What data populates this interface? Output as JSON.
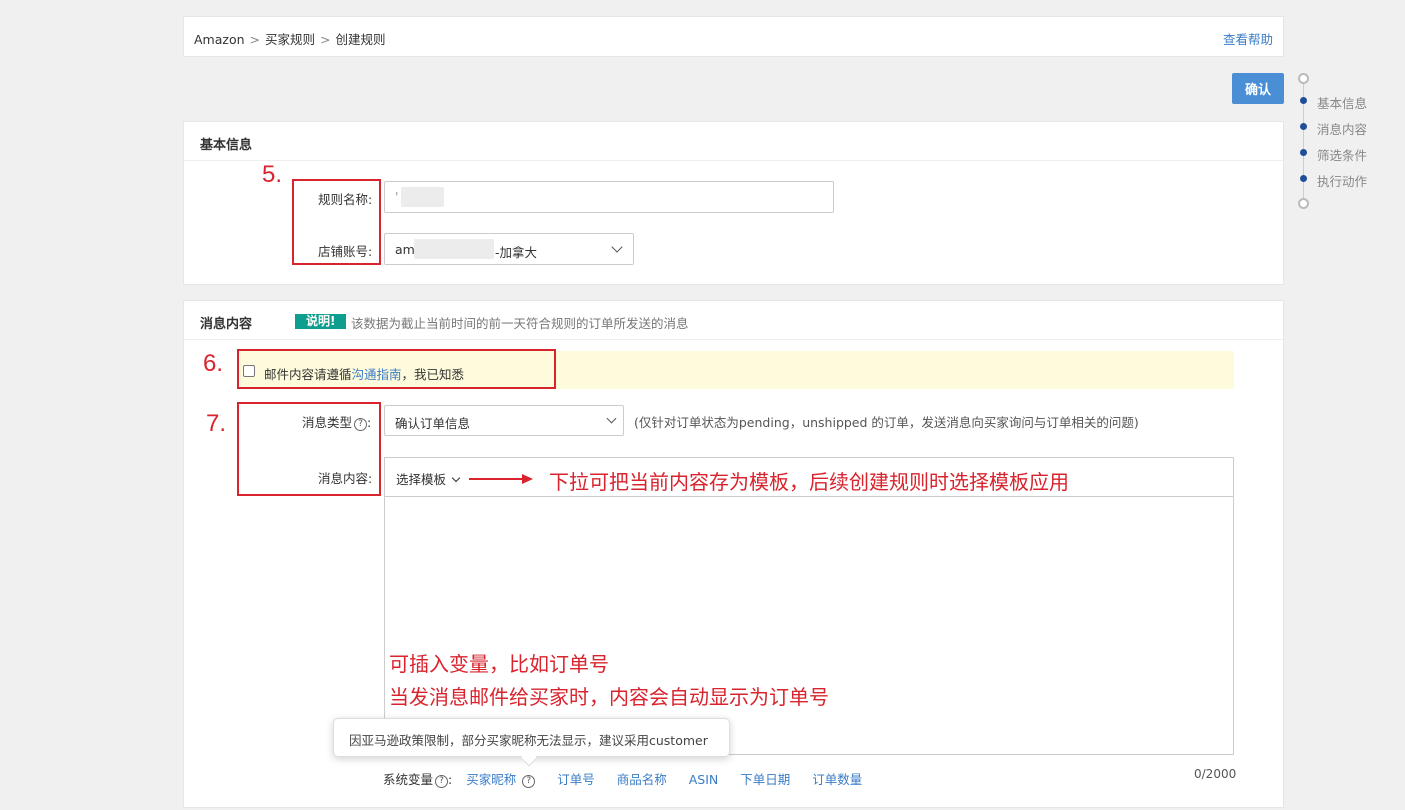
{
  "breadcrumb": {
    "items": [
      "Amazon",
      "买家规则",
      "创建规则"
    ],
    "separator": ">"
  },
  "help_link": "查看帮助",
  "confirm_button": "确认",
  "side_nav": {
    "items": [
      "基本信息",
      "消息内容",
      "筛选条件",
      "执行动作"
    ]
  },
  "basic": {
    "title": "基本信息",
    "rule_name_label": "规则名称:",
    "rule_name_value": "'",
    "store_label": "店铺账号:",
    "store_prefix": "am",
    "store_suffix": "-加拿大"
  },
  "message": {
    "title": "消息内容",
    "badge": "说明!",
    "badge_note": "该数据为截止当前时间的前一天符合规则的订单所发送的消息",
    "notice_before": "邮件内容请遵循",
    "notice_link": "沟通指南",
    "notice_after": "，我已知悉",
    "type_label": "消息类型",
    "type_value": "确认订单信息",
    "type_hint": "(仅针对订单状态为pending，unshipped 的订单，发送消息向买家询问与订单相关的问题)",
    "content_label": "消息内容:",
    "template_select": "选择模板",
    "tooltip": "因亚马逊政策限制，部分买家昵称无法显示，建议采用customer",
    "vars_label": "系统变量",
    "variables": [
      "买家昵称",
      "订单号",
      "商品名称",
      "ASIN",
      "下单日期",
      "订单数量"
    ],
    "counter": "0/2000"
  },
  "annotations": {
    "n5": "5.",
    "n6": "6.",
    "n7": "7.",
    "template_note": "下拉可把当前内容存为模板，后续创建规则时选择模板应用",
    "variable_note_1": "可插入变量，比如订单号",
    "variable_note_2": "当发消息邮件给买家时，内容会自动显示为订单号"
  },
  "colors": {
    "link": "#3a7cc7",
    "primary": "#4a8fd6",
    "badge": "#0e9e8f",
    "annotation": "#d9232d",
    "notice_bg": "#fefbdc"
  }
}
